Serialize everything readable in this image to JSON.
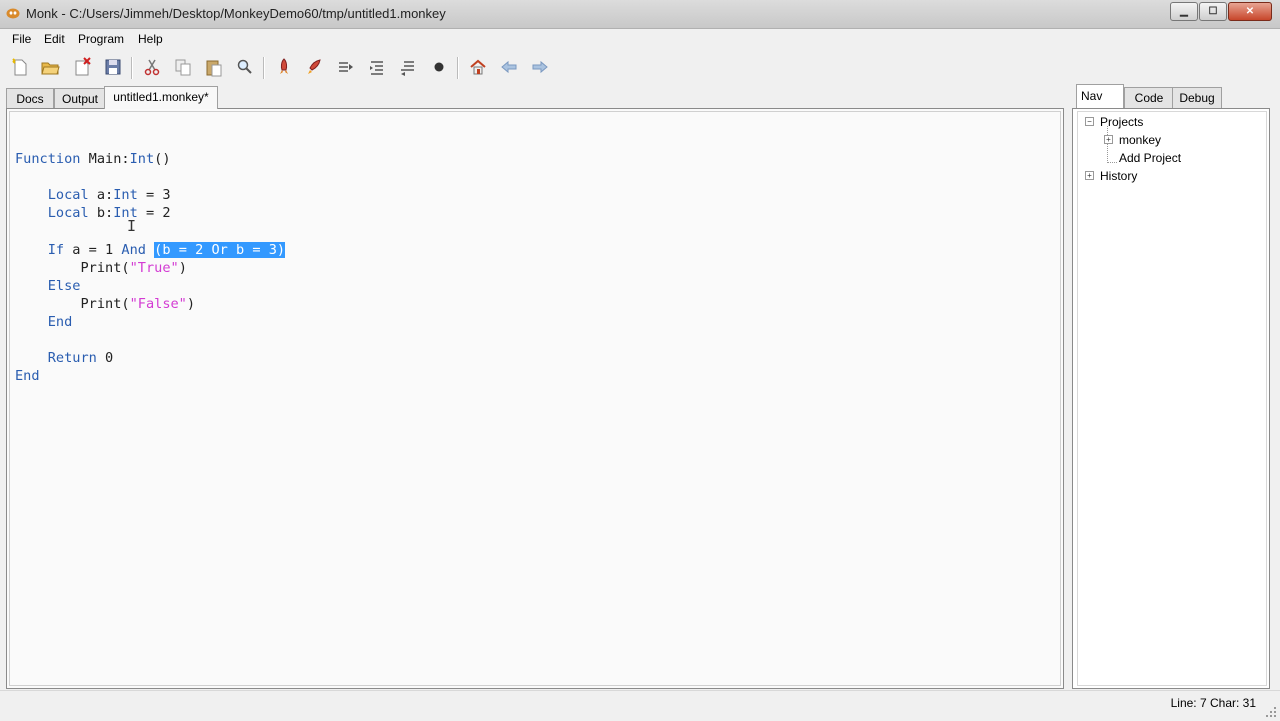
{
  "window": {
    "title": "Monk - C:/Users/Jimmeh/Desktop/MonkeyDemo60/tmp/untitled1.monkey"
  },
  "menu": [
    "File",
    "Edit",
    "Program",
    "Help"
  ],
  "toolbar": {
    "icons": [
      "new-file-icon",
      "open-folder-icon",
      "close-file-icon",
      "save-icon",
      "cut-icon",
      "copy-icon",
      "paste-icon",
      "find-icon",
      "build-icon",
      "build-and-run-icon",
      "step-icon",
      "step-in-icon",
      "step-out-icon",
      "kill-icon",
      "home-icon",
      "back-icon",
      "forward-icon"
    ]
  },
  "tabs": {
    "docs": "Docs",
    "output": "Output",
    "file": "untitled1.monkey*"
  },
  "editor": {
    "lines": [
      "",
      "Function Main:Int()",
      "",
      "    Local a:Int = 3",
      "    Local b:Int = 2",
      "",
      "    If a = 1 And (b = 2 Or b = 3)",
      "        Print(\"True\")",
      "    Else",
      "        Print(\"False\")",
      "    End",
      "",
      "    Return 0",
      "End"
    ],
    "selected_text": "(b = 2 Or b = 3)"
  },
  "right_tabs": {
    "nav": "Nav",
    "code": "Code",
    "debug": "Debug"
  },
  "nav_tree": {
    "projects": "Projects",
    "monkey": "monkey",
    "add_project": "Add Project",
    "history": "History"
  },
  "status": {
    "position": "Line: 7 Char: 31"
  },
  "colors": {
    "keyword": "#2a5db0",
    "string": "#d33bd3",
    "selection": "#3399ff"
  }
}
